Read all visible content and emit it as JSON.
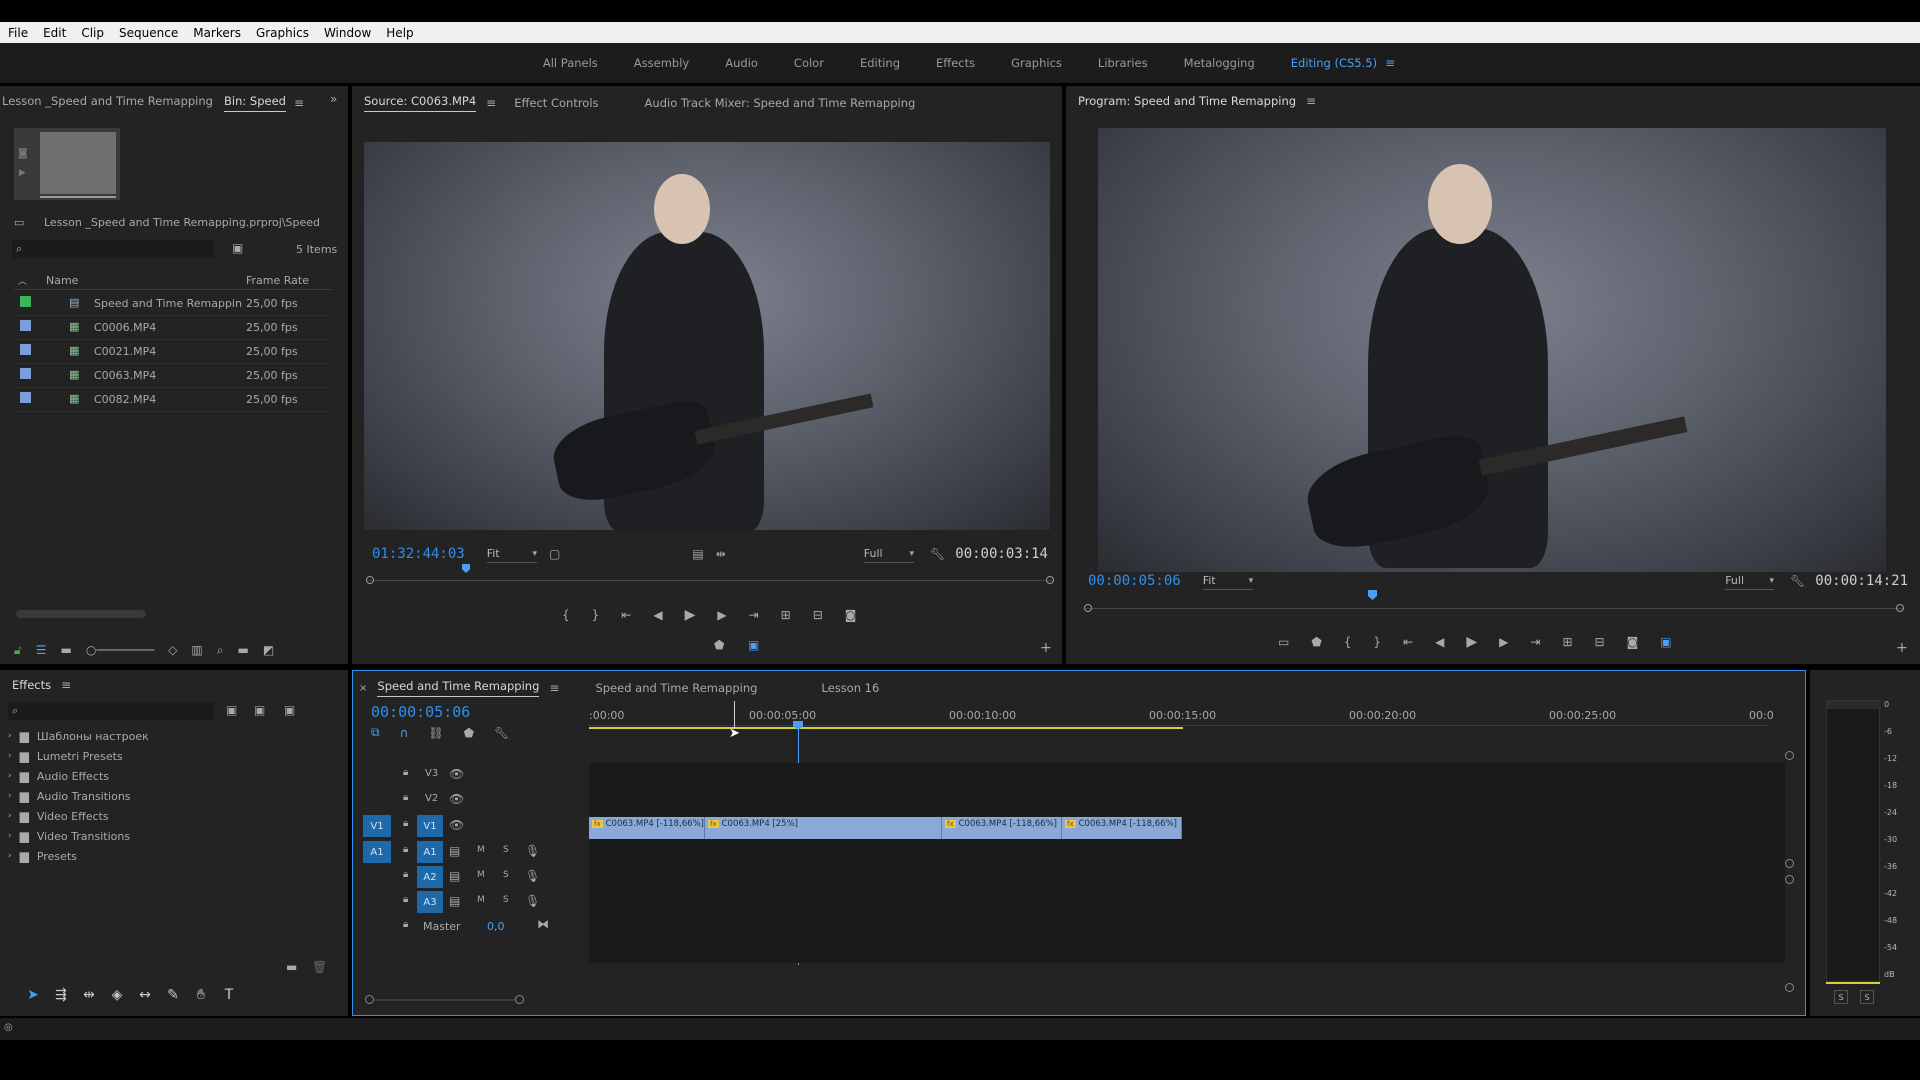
{
  "menu": [
    "File",
    "Edit",
    "Clip",
    "Sequence",
    "Markers",
    "Graphics",
    "Window",
    "Help"
  ],
  "workspaces": [
    {
      "label": "All Panels",
      "active": false
    },
    {
      "label": "Assembly",
      "active": false
    },
    {
      "label": "Audio",
      "active": false
    },
    {
      "label": "Color",
      "active": false
    },
    {
      "label": "Editing",
      "active": false
    },
    {
      "label": "Effects",
      "active": false
    },
    {
      "label": "Graphics",
      "active": false
    },
    {
      "label": "Libraries",
      "active": false
    },
    {
      "label": "Metalogging",
      "active": false
    },
    {
      "label": "Editing (CS5.5)",
      "active": true
    }
  ],
  "project": {
    "tab_project": "Lesson _Speed and Time Remapping",
    "tab_bin": "Bin: Speed",
    "path": "Lesson _Speed and Time Remapping.prproj\\Speed",
    "count": "5 Items",
    "col_name": "Name",
    "col_rate": "Frame Rate",
    "rows": [
      {
        "name": "Speed and Time Remappin",
        "rate": "25,00 fps",
        "color": "#3db35a",
        "icon": "sequence-icon"
      },
      {
        "name": "C0006.MP4",
        "rate": "25,00 fps",
        "color": "#7a9ed8",
        "icon": "clip-icon"
      },
      {
        "name": "C0021.MP4",
        "rate": "25,00 fps",
        "color": "#7a9ed8",
        "icon": "clip-icon"
      },
      {
        "name": "C0063.MP4",
        "rate": "25,00 fps",
        "color": "#7a9ed8",
        "icon": "clip-icon"
      },
      {
        "name": "C0082.MP4",
        "rate": "25,00 fps",
        "color": "#7a9ed8",
        "icon": "clip-icon"
      }
    ]
  },
  "source": {
    "tab_source": "Source: C0063.MP4",
    "tab_effects": "Effect Controls",
    "tab_mixer": "Audio Track Mixer: Speed and Time Remapping",
    "timecode": "01:32:44:03",
    "fit": "Fit",
    "quality": "Full",
    "duration": "00:00:03:14"
  },
  "program": {
    "tab": "Program: Speed and Time Remapping",
    "timecode": "00:00:05:06",
    "fit": "Fit",
    "quality": "Full",
    "duration": "00:00:14:21"
  },
  "effects": {
    "tab": "Effects",
    "items": [
      "Шаблоны настроек",
      "Lumetri Presets",
      "Audio Effects",
      "Audio Transitions",
      "Video Effects",
      "Video Transitions",
      "Presets"
    ]
  },
  "timeline": {
    "tabs": [
      "Speed and Time Remapping",
      "Speed and Time Remapping",
      "Lesson 16"
    ],
    "timecode": "00:00:05:06",
    "ruler": [
      ":00:00",
      "00:00:05:00",
      "00:00:10:00",
      "00:00:15:00",
      "00:00:20:00",
      "00:00:25:00",
      "00:0"
    ],
    "video_tracks": [
      "V3",
      "V2",
      "V1"
    ],
    "audio_tracks": [
      "A1",
      "A2",
      "A3"
    ],
    "src_v": "V1",
    "src_a": "A1",
    "master": "Master",
    "master_val": "0,0",
    "mute": "M",
    "solo": "S",
    "clips": [
      {
        "label": "C0063.MP4 [-118,66%]"
      },
      {
        "label": "C0063.MP4 [25%]"
      },
      {
        "label": "C0063.MP4 [-118,66%]"
      },
      {
        "label": "C0063.MP4 [-118,66%]"
      }
    ]
  },
  "meter": {
    "scale": [
      "0",
      "-6",
      "-12",
      "-18",
      "-24",
      "-30",
      "-36",
      "-42",
      "-48",
      "-54",
      "dB"
    ],
    "solo_l": "S",
    "solo_r": "S"
  }
}
